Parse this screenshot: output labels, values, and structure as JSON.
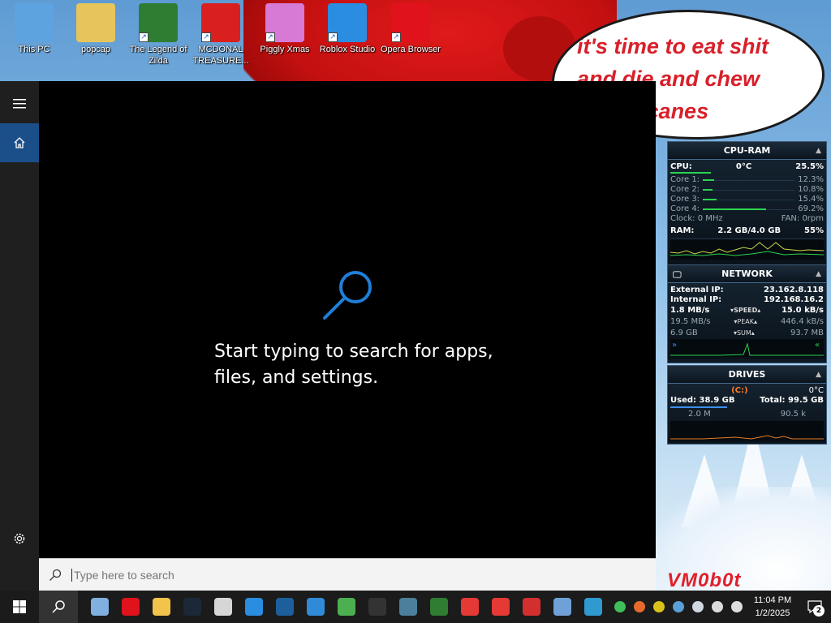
{
  "desktop": {
    "icons": [
      {
        "label": "This PC",
        "icon": "this-pc-icon",
        "color": "#5da3e0",
        "shortcut": false
      },
      {
        "label": "popcap",
        "icon": "folder-icon",
        "color": "#e7c55a",
        "shortcut": false
      },
      {
        "label": "The Legend of Zilda",
        "icon": "game-icon",
        "color": "#2e7d32",
        "shortcut": true
      },
      {
        "label": "MCDONAL TREASURE...",
        "icon": "mcdonalds-icon",
        "color": "#da1f1f",
        "shortcut": true
      },
      {
        "label": "Piggly Xmas",
        "icon": "pig-icon",
        "color": "#d67ad6",
        "shortcut": true
      },
      {
        "label": "Roblox Studio",
        "icon": "roblox-studio-icon",
        "color": "#2a8de0",
        "shortcut": true
      },
      {
        "label": "Opera Browser",
        "icon": "opera-icon",
        "color": "#e0131c",
        "shortcut": true
      }
    ],
    "bubble_text": "it's time to eat shit and die and chew candy canes",
    "watermark": "VM0b0t"
  },
  "search_panel": {
    "hint": "Start typing to search for apps, files, and settings.",
    "search_placeholder": "Type here to search"
  },
  "gadgets": {
    "cpu_ram": {
      "title": "CPU-RAM",
      "cpu_label": "CPU:",
      "cpu_temp": "0°C",
      "cpu_value": "25.5%",
      "cores": [
        {
          "label": "Core 1:",
          "value": "12.3%",
          "fill": 0.12
        },
        {
          "label": "Core 2:",
          "value": "10.8%",
          "fill": 0.11
        },
        {
          "label": "Core 3:",
          "value": "15.4%",
          "fill": 0.15
        },
        {
          "label": "Core 4:",
          "value": "69.2%",
          "fill": 0.69
        }
      ],
      "clock": "Clock: 0 MHz",
      "fan": "FAN: 0rpm",
      "ram_label": "RAM:",
      "ram_value": "2.2 GB/4.0 GB",
      "ram_pct": "55%"
    },
    "network": {
      "title": "NETWORK",
      "ext_label": "External IP:",
      "ext_ip": "23.162.8.118",
      "int_label": "Internal IP:",
      "int_ip": "192.168.16.2",
      "down_speed": "1.8 MB/s",
      "speed_label": "SPEED",
      "up_speed": "15.0 kB/s",
      "down_peak": "19.5 MB/s",
      "peak_label": "PEAK",
      "up_peak": "446.4 kB/s",
      "down_sum": "6.9 GB",
      "sum_label": "SUM",
      "up_sum": "93.7 MB"
    },
    "drives": {
      "title": "DRIVES",
      "drive": "(C:)",
      "temp": "0°C",
      "used": "Used: 38.9 GB",
      "total": "Total: 99.5 GB",
      "read": "2.0 M",
      "write": "90.5 k"
    }
  },
  "taskbar": {
    "apps": [
      {
        "name": "media-player-icon",
        "color": "#7fb0e0"
      },
      {
        "name": "opera-icon",
        "color": "#e0131c"
      },
      {
        "name": "file-explorer-icon",
        "color": "#f2c44c"
      },
      {
        "name": "steam-icon",
        "color": "#1b2838"
      },
      {
        "name": "roblox-icon",
        "color": "#d6d6d6"
      },
      {
        "name": "roblox-studio-icon",
        "color": "#2a8de0"
      },
      {
        "name": "virtualbox-icon",
        "color": "#1d5f9c"
      },
      {
        "name": "ie-icon",
        "color": "#2f8bd8"
      },
      {
        "name": "chrome-icon",
        "color": "#4caf50"
      },
      {
        "name": "obs-icon",
        "color": "#333333"
      },
      {
        "name": "app-window-icon",
        "color": "#4b7f9b"
      },
      {
        "name": "spreadsheet-icon",
        "color": "#2e7d32"
      },
      {
        "name": "yandex-browser-icon",
        "color": "#e53935"
      },
      {
        "name": "yandex-icon",
        "color": "#e53935"
      },
      {
        "name": "opera-gx-icon",
        "color": "#d32f2f"
      },
      {
        "name": "control-panel-icon",
        "color": "#6fa1d8"
      },
      {
        "name": "ie-old-icon",
        "color": "#2e9ad0"
      }
    ],
    "tray": [
      {
        "name": "green-arrows-icon",
        "color": "#3fbf5a"
      },
      {
        "name": "antivirus-icon",
        "color": "#e66a2c"
      },
      {
        "name": "plus-badge-icon",
        "color": "#d9c21a"
      },
      {
        "name": "network-monitor-icon",
        "color": "#5aa0d8"
      },
      {
        "name": "drop-icon",
        "color": "#cfd8e0"
      },
      {
        "name": "ethernet-icon",
        "color": "#dddddd"
      },
      {
        "name": "volume-muted-icon",
        "color": "#dddddd"
      }
    ],
    "time": "11:04 PM",
    "date": "1/2/2025",
    "notifications_count": "2"
  }
}
